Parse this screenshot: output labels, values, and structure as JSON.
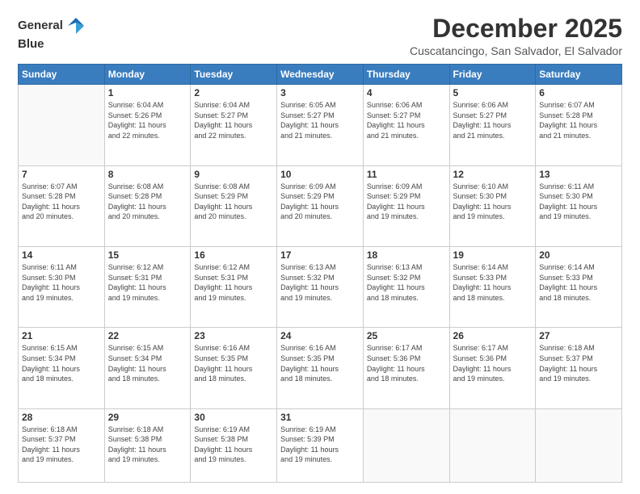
{
  "logo": {
    "line1": "General",
    "line2": "Blue"
  },
  "title": "December 2025",
  "subtitle": "Cuscatancingo, San Salvador, El Salvador",
  "header": {
    "days": [
      "Sunday",
      "Monday",
      "Tuesday",
      "Wednesday",
      "Thursday",
      "Friday",
      "Saturday"
    ]
  },
  "weeks": [
    [
      {
        "day": "",
        "info": ""
      },
      {
        "day": "1",
        "info": "Sunrise: 6:04 AM\nSunset: 5:26 PM\nDaylight: 11 hours\nand 22 minutes."
      },
      {
        "day": "2",
        "info": "Sunrise: 6:04 AM\nSunset: 5:27 PM\nDaylight: 11 hours\nand 22 minutes."
      },
      {
        "day": "3",
        "info": "Sunrise: 6:05 AM\nSunset: 5:27 PM\nDaylight: 11 hours\nand 21 minutes."
      },
      {
        "day": "4",
        "info": "Sunrise: 6:06 AM\nSunset: 5:27 PM\nDaylight: 11 hours\nand 21 minutes."
      },
      {
        "day": "5",
        "info": "Sunrise: 6:06 AM\nSunset: 5:27 PM\nDaylight: 11 hours\nand 21 minutes."
      },
      {
        "day": "6",
        "info": "Sunrise: 6:07 AM\nSunset: 5:28 PM\nDaylight: 11 hours\nand 21 minutes."
      }
    ],
    [
      {
        "day": "7",
        "info": "Sunrise: 6:07 AM\nSunset: 5:28 PM\nDaylight: 11 hours\nand 20 minutes."
      },
      {
        "day": "8",
        "info": "Sunrise: 6:08 AM\nSunset: 5:28 PM\nDaylight: 11 hours\nand 20 minutes."
      },
      {
        "day": "9",
        "info": "Sunrise: 6:08 AM\nSunset: 5:29 PM\nDaylight: 11 hours\nand 20 minutes."
      },
      {
        "day": "10",
        "info": "Sunrise: 6:09 AM\nSunset: 5:29 PM\nDaylight: 11 hours\nand 20 minutes."
      },
      {
        "day": "11",
        "info": "Sunrise: 6:09 AM\nSunset: 5:29 PM\nDaylight: 11 hours\nand 19 minutes."
      },
      {
        "day": "12",
        "info": "Sunrise: 6:10 AM\nSunset: 5:30 PM\nDaylight: 11 hours\nand 19 minutes."
      },
      {
        "day": "13",
        "info": "Sunrise: 6:11 AM\nSunset: 5:30 PM\nDaylight: 11 hours\nand 19 minutes."
      }
    ],
    [
      {
        "day": "14",
        "info": "Sunrise: 6:11 AM\nSunset: 5:30 PM\nDaylight: 11 hours\nand 19 minutes."
      },
      {
        "day": "15",
        "info": "Sunrise: 6:12 AM\nSunset: 5:31 PM\nDaylight: 11 hours\nand 19 minutes."
      },
      {
        "day": "16",
        "info": "Sunrise: 6:12 AM\nSunset: 5:31 PM\nDaylight: 11 hours\nand 19 minutes."
      },
      {
        "day": "17",
        "info": "Sunrise: 6:13 AM\nSunset: 5:32 PM\nDaylight: 11 hours\nand 19 minutes."
      },
      {
        "day": "18",
        "info": "Sunrise: 6:13 AM\nSunset: 5:32 PM\nDaylight: 11 hours\nand 18 minutes."
      },
      {
        "day": "19",
        "info": "Sunrise: 6:14 AM\nSunset: 5:33 PM\nDaylight: 11 hours\nand 18 minutes."
      },
      {
        "day": "20",
        "info": "Sunrise: 6:14 AM\nSunset: 5:33 PM\nDaylight: 11 hours\nand 18 minutes."
      }
    ],
    [
      {
        "day": "21",
        "info": "Sunrise: 6:15 AM\nSunset: 5:34 PM\nDaylight: 11 hours\nand 18 minutes."
      },
      {
        "day": "22",
        "info": "Sunrise: 6:15 AM\nSunset: 5:34 PM\nDaylight: 11 hours\nand 18 minutes."
      },
      {
        "day": "23",
        "info": "Sunrise: 6:16 AM\nSunset: 5:35 PM\nDaylight: 11 hours\nand 18 minutes."
      },
      {
        "day": "24",
        "info": "Sunrise: 6:16 AM\nSunset: 5:35 PM\nDaylight: 11 hours\nand 18 minutes."
      },
      {
        "day": "25",
        "info": "Sunrise: 6:17 AM\nSunset: 5:36 PM\nDaylight: 11 hours\nand 18 minutes."
      },
      {
        "day": "26",
        "info": "Sunrise: 6:17 AM\nSunset: 5:36 PM\nDaylight: 11 hours\nand 19 minutes."
      },
      {
        "day": "27",
        "info": "Sunrise: 6:18 AM\nSunset: 5:37 PM\nDaylight: 11 hours\nand 19 minutes."
      }
    ],
    [
      {
        "day": "28",
        "info": "Sunrise: 6:18 AM\nSunset: 5:37 PM\nDaylight: 11 hours\nand 19 minutes."
      },
      {
        "day": "29",
        "info": "Sunrise: 6:18 AM\nSunset: 5:38 PM\nDaylight: 11 hours\nand 19 minutes."
      },
      {
        "day": "30",
        "info": "Sunrise: 6:19 AM\nSunset: 5:38 PM\nDaylight: 11 hours\nand 19 minutes."
      },
      {
        "day": "31",
        "info": "Sunrise: 6:19 AM\nSunset: 5:39 PM\nDaylight: 11 hours\nand 19 minutes."
      },
      {
        "day": "",
        "info": ""
      },
      {
        "day": "",
        "info": ""
      },
      {
        "day": "",
        "info": ""
      }
    ]
  ]
}
